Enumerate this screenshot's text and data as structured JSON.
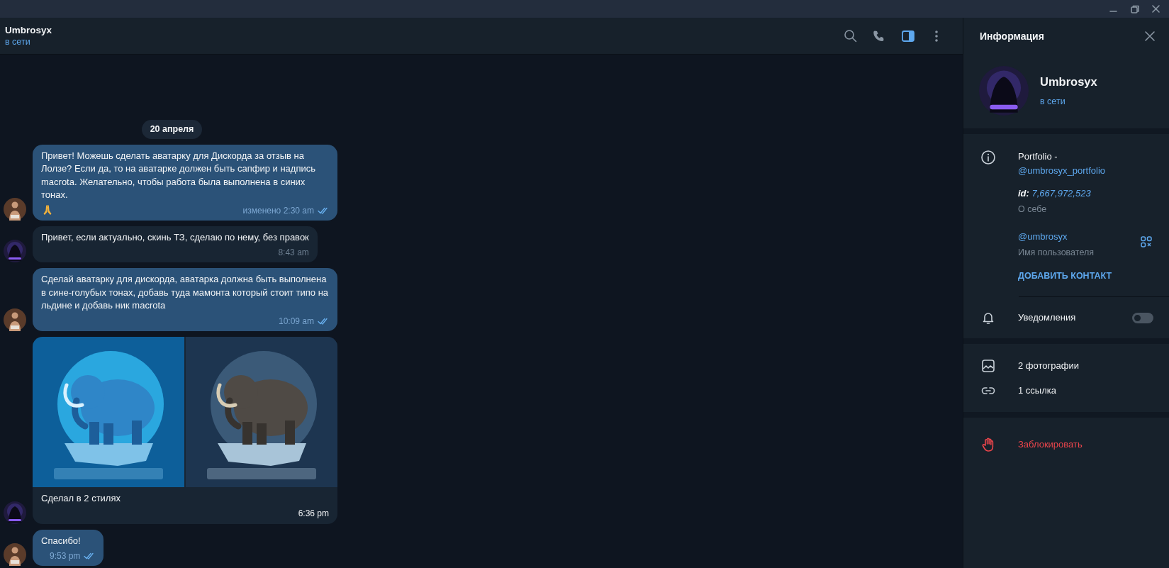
{
  "chat_header": {
    "title": "Umbrosyx",
    "status": "в сети",
    "info_panel_open": true
  },
  "date_separator": "20 апреля",
  "messages": [
    {
      "kind": "text",
      "outgoing": true,
      "text": "Привет! Можешь сделать аватарку для Дискорда за отзыв на Лолзе? Если да, то на аватарке должен быть сапфир и надпись macrota. Желательно, чтобы работа была выполнена в синих тонах.",
      "praying_emoji": true,
      "meta": "изменено 2:30 am",
      "read": true
    },
    {
      "kind": "text",
      "outgoing": false,
      "text": "Привет, если актуально, скинь ТЗ, сделаю по нему, без правок",
      "meta": "8:43 am"
    },
    {
      "kind": "text",
      "outgoing": true,
      "text": "Сделай аватарку для дискорда, аватарка должна быть выполнена в сине-голубых тонах, добавь туда мамонта который стоит типо на льдине и добавь ник macrota",
      "meta": "10:09 am",
      "read": true
    },
    {
      "kind": "album",
      "outgoing": false,
      "text": "Сделал в 2 стилях",
      "meta": "6:36 pm"
    },
    {
      "kind": "text",
      "outgoing": true,
      "text": "Спасибо!",
      "meta": "9:53 pm",
      "read": true
    }
  ],
  "info_panel": {
    "title": "Информация",
    "name": "Umbrosyx",
    "status": "в сети",
    "bio": {
      "text": "Portfolio -",
      "link": "@umbrosyx_portfolio",
      "id_label": "id:",
      "id_value": "7,667,972,523",
      "caption": "О себе"
    },
    "username": {
      "value": "@umbrosyx",
      "caption": "Имя пользователя"
    },
    "add_contact": "ДОБАВИТЬ КОНТАКТ",
    "notifications": {
      "label": "Уведомления",
      "on": false
    },
    "media": [
      {
        "kind": "photos",
        "label": "2 фотографии"
      },
      {
        "kind": "links",
        "label": "1 ссылка"
      }
    ],
    "block": "Заблокировать"
  }
}
